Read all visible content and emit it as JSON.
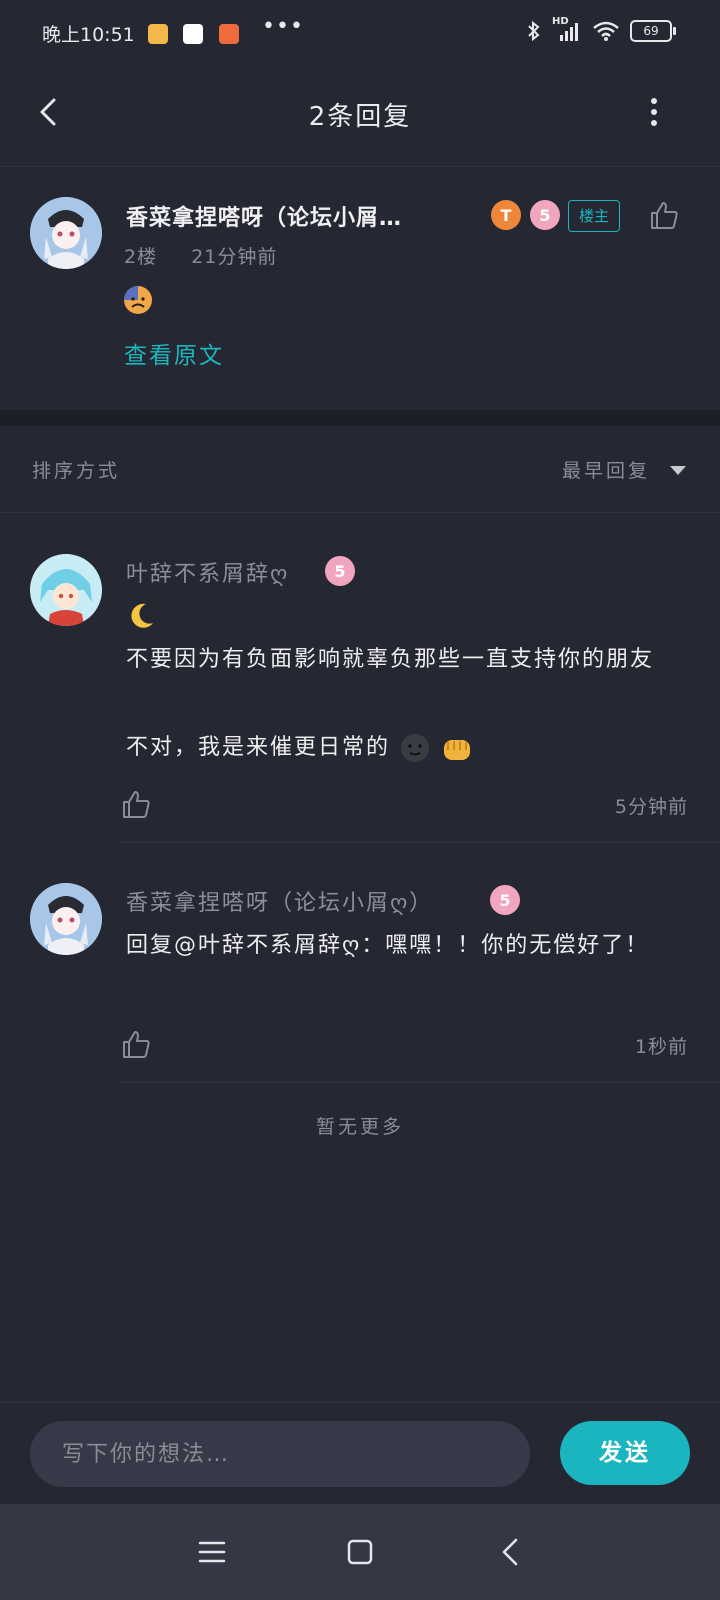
{
  "status_bar": {
    "time": "晚上10:51",
    "dots": "•••",
    "network": "HD",
    "battery": "69"
  },
  "header": {
    "title": "2条回复"
  },
  "post": {
    "author": "香菜拿捏嗒呀（论坛小屑…",
    "badge_letter": "T",
    "level": "5",
    "host_tag": "楼主",
    "floor": "2楼",
    "time": "21分钟前",
    "view_original": "查看原文"
  },
  "sort": {
    "label": "排序方式",
    "value": "最早回复"
  },
  "replies": [
    {
      "author": "叶辞不系屑辞ღ",
      "level": "5",
      "line1": "不要因为有负面影响就辜负那些一直支持你的朋友",
      "line2": "不对，我是来催更日常的",
      "time": "5分钟前"
    },
    {
      "author": "香菜拿捏嗒呀（论坛小屑ღ）",
      "level": "5",
      "text": "回复@叶辞不系屑辞ღ：嘿嘿！！你的无偿好了！",
      "time": "1秒前"
    }
  ],
  "no_more": "暂无更多",
  "composer": {
    "placeholder": "写下你的想法…",
    "send_label": "发送"
  },
  "colors": {
    "background": "#252732",
    "accent": "#1bb5bf",
    "secondary_text": "#8a8d96"
  }
}
